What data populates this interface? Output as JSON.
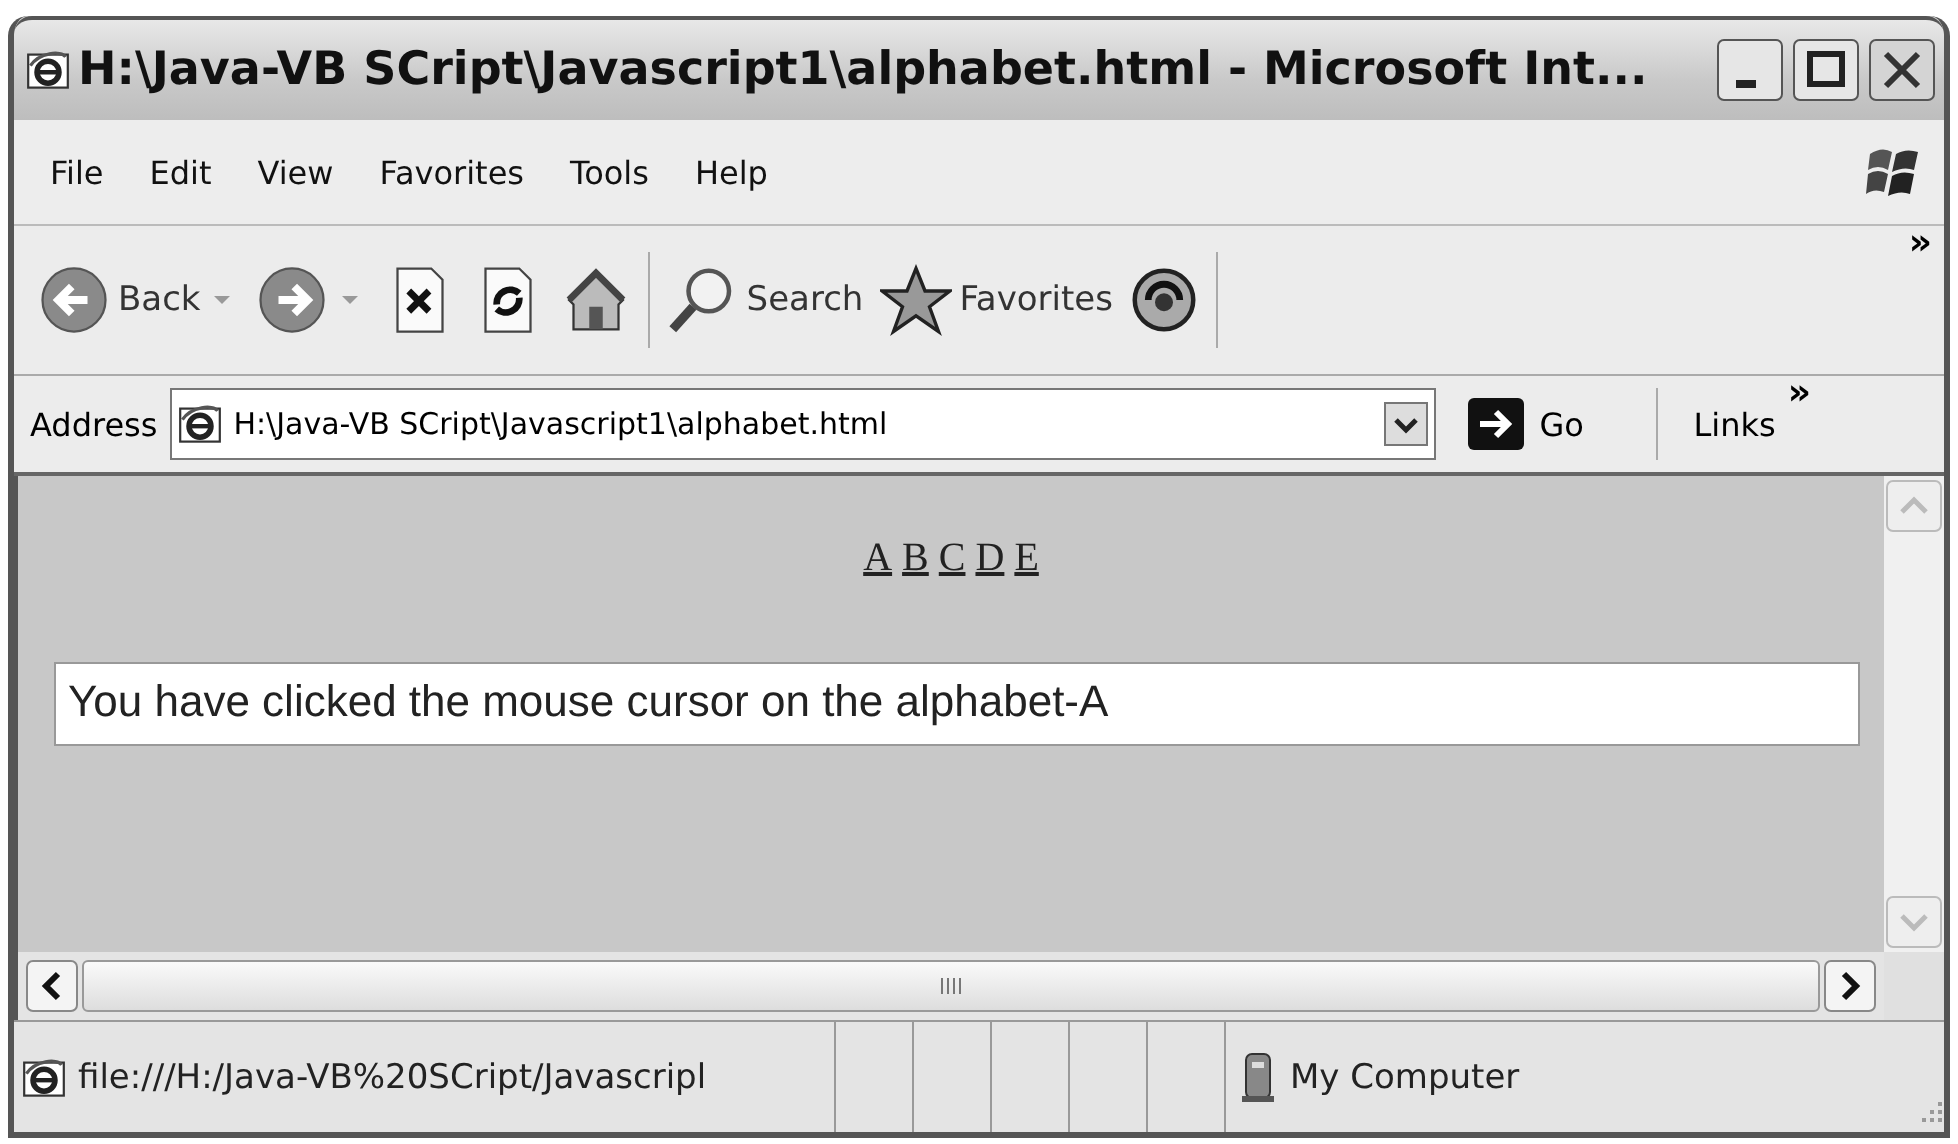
{
  "window": {
    "title": "H:\\Java-VB SCript\\Javascript1\\alphabet.html - Microsoft Int..."
  },
  "menu": [
    "File",
    "Edit",
    "View",
    "Favorites",
    "Tools",
    "Help"
  ],
  "toolbar": [
    {
      "kind": "back",
      "label": "Back"
    },
    {
      "kind": "forward"
    },
    {
      "kind": "stop"
    },
    {
      "kind": "refresh"
    },
    {
      "kind": "home"
    },
    {
      "kind": "search",
      "label": "Search"
    },
    {
      "kind": "favorites",
      "label": "Favorites"
    },
    {
      "kind": "media"
    }
  ],
  "toolbar_overflow": "»",
  "address": {
    "label": "Address",
    "value": "H:\\Java-VB SCript\\Javascript1\\alphabet.html",
    "go": "Go",
    "links": "Links",
    "links_overflow": "»"
  },
  "page": {
    "links": [
      "A",
      "B",
      "C",
      "D",
      "E"
    ],
    "message": "You have clicked the mouse cursor on the alphabet-A"
  },
  "status_bar": {
    "url": "file:///H:/Java-VB%20SCript/Javascripl",
    "zone": "My Computer"
  }
}
